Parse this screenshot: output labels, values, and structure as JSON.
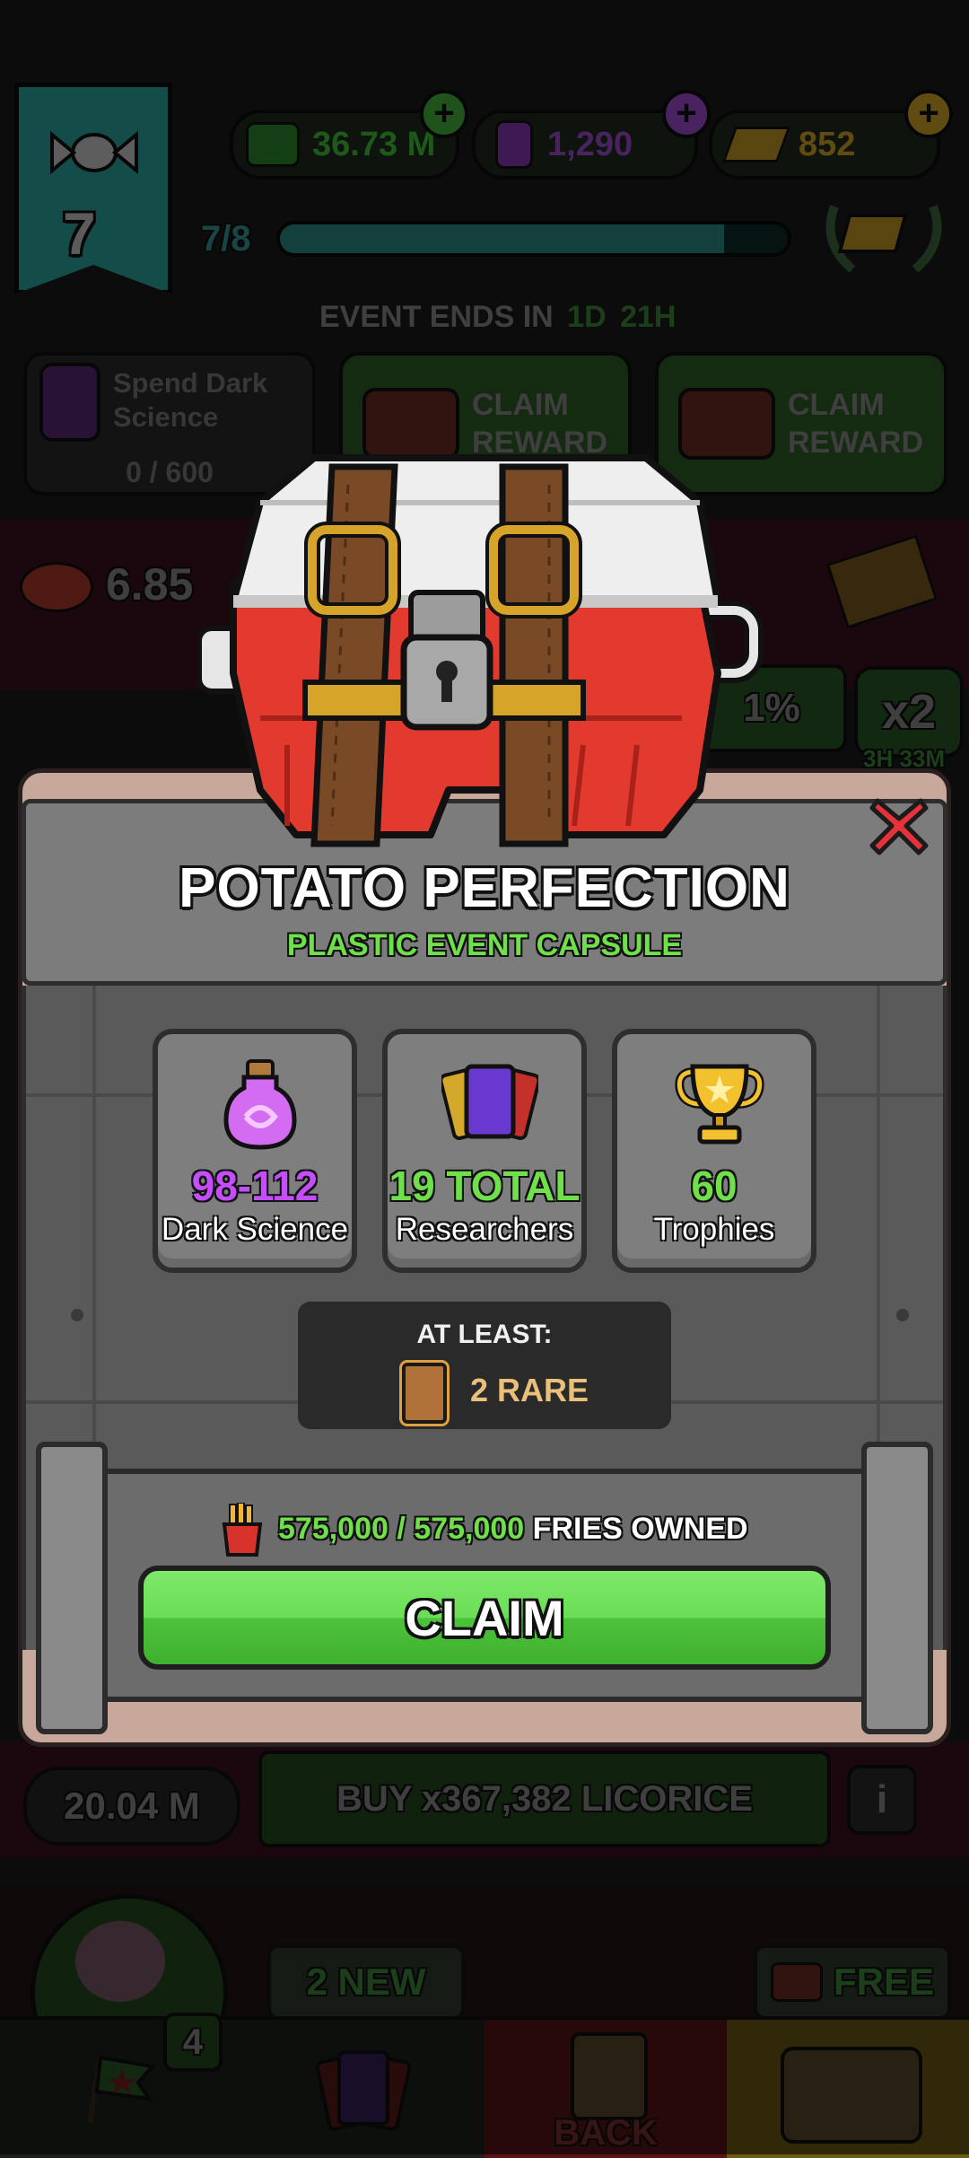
{
  "top_bar": {
    "level": "7",
    "currency_1": "36.73 M",
    "currency_2": "1,290",
    "currency_3": "852",
    "progress_text": "7/8",
    "progress_fraction": 0.875
  },
  "event": {
    "ends_label": "EVENT ENDS IN",
    "days": "1D",
    "hours": "21H",
    "task_title": "Spend Dark Science",
    "task_progress": "0 / 600",
    "claim_reward_1": "CLAIM REWARD",
    "claim_reward_2": "CLAIM REWARD"
  },
  "background": {
    "candy_amount": "6.85",
    "percent": "1%",
    "multiplier": "x2",
    "timer": "3H 33M",
    "balance": "20.04 M",
    "buy_label": "BUY x367,382 LICORICE",
    "info": "i",
    "cards_badge": "4",
    "new_badge": "2 NEW",
    "free_badge": "FREE",
    "back_label": "BACK"
  },
  "modal": {
    "title": "POTATO PERFECTION",
    "subtitle": "PLASTIC EVENT CAPSULE",
    "close_icon": "close-icon",
    "rewards": [
      {
        "icon": "dark-science-jar-icon",
        "value": "98-112",
        "label": "Dark Science",
        "color": "#c64dff"
      },
      {
        "icon": "researcher-cards-icon",
        "value": "19 TOTAL",
        "label": "Researchers",
        "color": "#6fe04a"
      },
      {
        "icon": "trophy-icon",
        "value": "60",
        "label": "Trophies",
        "color": "#6fe04a"
      }
    ],
    "at_least_label": "AT LEAST:",
    "rare_label": "2 RARE",
    "fries_have": "575,000",
    "fries_sep": "/",
    "fries_need": "575,000",
    "fries_suffix": "FRIES OWNED",
    "claim_label": "CLAIM"
  },
  "colors": {
    "accent_green": "#6fe04a",
    "accent_purple": "#c64dff",
    "close_red": "#e8323a",
    "capsule_red": "#e23a2e"
  }
}
